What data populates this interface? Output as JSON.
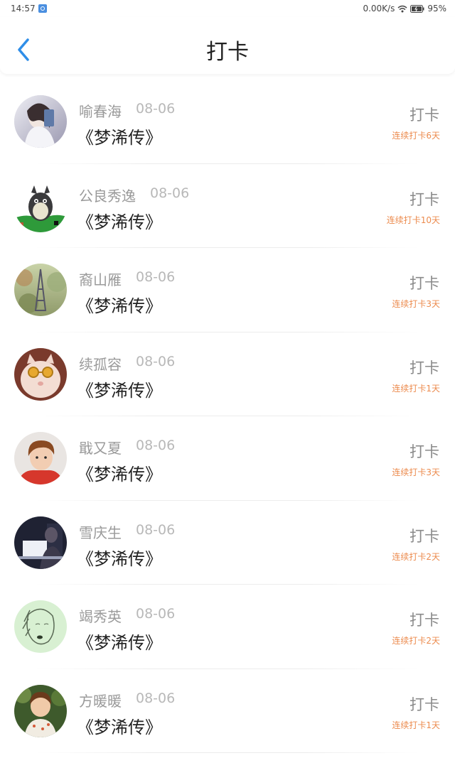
{
  "status_bar": {
    "time": "14:57",
    "network_speed": "0.00K/s",
    "battery": "95%",
    "icons": [
      "app-notification-icon",
      "wifi-icon",
      "battery-icon"
    ]
  },
  "header": {
    "title": "打卡",
    "back_icon": "chevron-left-icon",
    "accent_color": "#2f8ee8"
  },
  "entries": [
    {
      "name": "喻春海",
      "date": "08-06",
      "book": "《梦浠传》",
      "action": "打卡",
      "streak": "连续打卡6天"
    },
    {
      "name": "公良秀逸",
      "date": "08-06",
      "book": "《梦浠传》",
      "action": "打卡",
      "streak": "连续打卡10天"
    },
    {
      "name": "裔山雁",
      "date": "08-06",
      "book": "《梦浠传》",
      "action": "打卡",
      "streak": "连续打卡3天"
    },
    {
      "name": "续孤容",
      "date": "08-06",
      "book": "《梦浠传》",
      "action": "打卡",
      "streak": "连续打卡1天"
    },
    {
      "name": "戢又夏",
      "date": "08-06",
      "book": "《梦浠传》",
      "action": "打卡",
      "streak": "连续打卡3天"
    },
    {
      "name": "雪庆生",
      "date": "08-06",
      "book": "《梦浠传》",
      "action": "打卡",
      "streak": "连续打卡2天"
    },
    {
      "name": "竭秀英",
      "date": "08-06",
      "book": "《梦浠传》",
      "action": "打卡",
      "streak": "连续打卡2天"
    },
    {
      "name": "方暖暖",
      "date": "08-06",
      "book": "《梦浠传》",
      "action": "打卡",
      "streak": "连续打卡1天"
    }
  ],
  "colors": {
    "streak_text": "#ec8b4e",
    "name_text": "#9a9a9a",
    "book_text": "#222222"
  }
}
